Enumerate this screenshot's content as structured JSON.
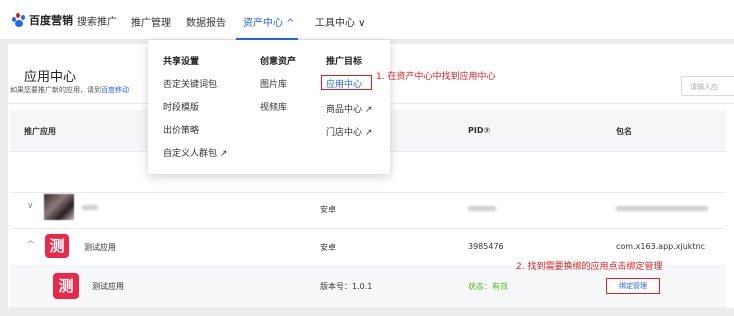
{
  "nav": {
    "brand": "百度营销",
    "brand_sub": "搜索推广",
    "items": [
      "推广管理",
      "数据报告",
      "资产中心 ^",
      "工具中心 ∨"
    ],
    "accent": "#2468f2"
  },
  "page": {
    "title": "应用中心",
    "hint_prefix": "如果您要推广新的应用，请到",
    "hint_link": "百度移动",
    "search_placeholder": "请输入应"
  },
  "table": {
    "headers": [
      "推广应用",
      "PID⑦",
      "包名"
    ],
    "rows": [
      {
        "chevron": "∨",
        "platform": "安卓",
        "pid": "",
        "package": ""
      },
      {
        "chevron": "^",
        "name": "测试应用",
        "icon_char": "测",
        "platform": "安卓",
        "pid": "3985476",
        "package": "com.x163.app.xjuktnc"
      }
    ],
    "subrow": {
      "icon_char": "测",
      "name": "测试应用",
      "version": "版本号：1.0.1",
      "status": "状态：有效",
      "action": "绑定管理"
    }
  },
  "dropdown": {
    "columns": [
      {
        "heading": "共享设置",
        "items": [
          "否定关键词包",
          "时段模版",
          "出价策略",
          "自定义人群包 ↗"
        ]
      },
      {
        "heading": "创意资产",
        "items": [
          "图片库",
          "视频库"
        ]
      },
      {
        "heading": "推广目标",
        "items": [
          "应用中心",
          "商品中心 ↗",
          "门店中心 ↗"
        ]
      }
    ]
  },
  "annotations": {
    "step1": "1. 在资产中心中找到应用中心",
    "step2": "2. 找到需要换绑的应用点击绑定管理",
    "color": "#e02020"
  }
}
